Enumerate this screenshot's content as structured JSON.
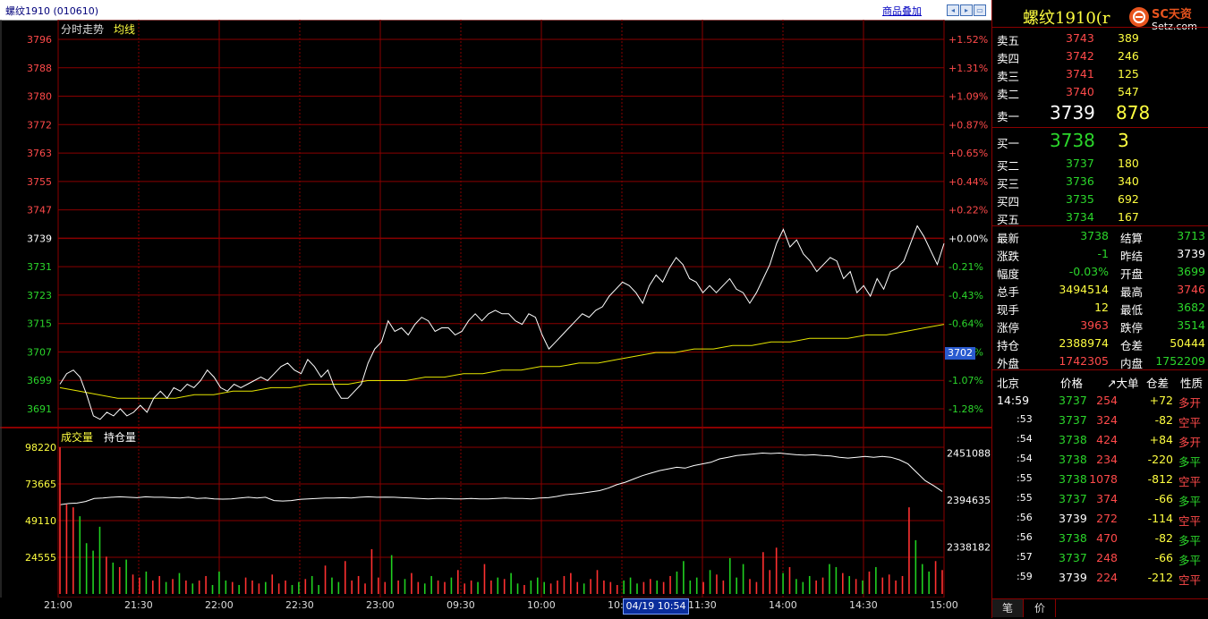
{
  "header": {
    "title": "螺纹1910 (010610)",
    "overlay_button": "商品叠加"
  },
  "chart_labels": {
    "price_caption": "分时走势",
    "avg_caption": "均线",
    "volume_caption": "成交量",
    "oi_caption": "持仓量",
    "current_price_flag": "3702",
    "cursor_time": "04/19 10:54"
  },
  "colors": {
    "up": "#ff4a4a",
    "down": "#2bd62b",
    "grid": "#8a0000",
    "price_line": "#ffffff",
    "avg_line": "#e6e600",
    "volume_up": "#ff3030",
    "volume_down": "#20d020"
  },
  "chart_data": [
    {
      "type": "line",
      "title": "分时走势",
      "y_left_ticks": [
        "3796",
        "3788",
        "3780",
        "3772",
        "3763",
        "3755",
        "3747",
        "3739",
        "3731",
        "3723",
        "3715",
        "3707",
        "3699",
        "3691"
      ],
      "y_right_ticks": [
        "+1.52%",
        "+1.31%",
        "+1.09%",
        "+0.87%",
        "+0.65%",
        "+0.44%",
        "+0.22%",
        "+0.00%",
        "-0.21%",
        "-0.43%",
        "-0.64%",
        "-0.86%",
        "-1.07%",
        "-1.28%"
      ],
      "ylim": [
        3687,
        3799
      ],
      "reference_price": 3739,
      "x_ticks": [
        "21:00",
        "21:30",
        "22:00",
        "22:30",
        "23:00",
        "09:30",
        "10:00",
        "10:30",
        "11:30",
        "14:00",
        "14:30",
        "15:00"
      ],
      "series": [
        {
          "name": "分时走势",
          "values": [
            3698,
            3701,
            3702,
            3700,
            3695,
            3689,
            3688,
            3690,
            3689,
            3691,
            3689,
            3690,
            3692,
            3690,
            3694,
            3696,
            3694,
            3697,
            3696,
            3698,
            3697,
            3699,
            3702,
            3700,
            3697,
            3696,
            3698,
            3697,
            3698,
            3699,
            3700,
            3699,
            3701,
            3703,
            3704,
            3702,
            3701,
            3705,
            3703,
            3700,
            3702,
            3697,
            3694,
            3694,
            3696,
            3698,
            3704,
            3708,
            3710,
            3716,
            3713,
            3714,
            3712,
            3715,
            3717,
            3716,
            3713,
            3714,
            3714,
            3712,
            3713,
            3716,
            3718,
            3716,
            3718,
            3719,
            3718,
            3718,
            3716,
            3715,
            3718,
            3717,
            3712,
            3708,
            3710,
            3712,
            3714,
            3716,
            3718,
            3717,
            3719,
            3720,
            3723,
            3725,
            3727,
            3726,
            3724,
            3721,
            3726,
            3729,
            3727,
            3731,
            3734,
            3732,
            3728,
            3727,
            3724,
            3726,
            3724,
            3726,
            3728,
            3725,
            3724,
            3721,
            3724,
            3728,
            3732,
            3738,
            3742,
            3737,
            3739,
            3735,
            3733,
            3730,
            3732,
            3734,
            3733,
            3728,
            3730,
            3724,
            3726,
            3723,
            3728,
            3725,
            3730,
            3731,
            3733,
            3738,
            3743,
            3740,
            3736,
            3732,
            3738
          ],
          "color": "#ffffff"
        },
        {
          "name": "均线",
          "values": [
            3697,
            3696,
            3695,
            3694,
            3694,
            3694,
            3694,
            3695,
            3695,
            3696,
            3696,
            3697,
            3697,
            3698,
            3698,
            3698,
            3699,
            3699,
            3699,
            3700,
            3700,
            3701,
            3701,
            3702,
            3702,
            3703,
            3703,
            3704,
            3704,
            3705,
            3706,
            3707,
            3707,
            3708,
            3708,
            3709,
            3709,
            3710,
            3710,
            3711,
            3711,
            3711,
            3712,
            3712,
            3713,
            3714,
            3715
          ],
          "color": "#e6e600"
        }
      ]
    },
    {
      "type": "bar",
      "title": "成交量",
      "y_left_ticks": [
        "98220",
        "73665",
        "49110",
        "24555"
      ],
      "y_right_ticks": [
        "2451088",
        "2394635",
        "2338182"
      ],
      "ylim": [
        0,
        98220
      ],
      "values": [
        98220,
        60000,
        58000,
        52000,
        34000,
        29000,
        45000,
        25000,
        21000,
        18000,
        23000,
        13000,
        11000,
        15000,
        9000,
        12000,
        8000,
        10000,
        14000,
        9000,
        7000,
        9000,
        12000,
        6000,
        15000,
        9000,
        8000,
        6000,
        11000,
        9000,
        7000,
        8000,
        13000,
        7000,
        9000,
        6000,
        8000,
        10000,
        12000,
        6000,
        19000,
        11000,
        8000,
        22000,
        9000,
        12000,
        7000,
        30000,
        11000,
        8000,
        26000,
        9000,
        10000,
        14000,
        8000,
        7000,
        12000,
        9000,
        8000,
        11000,
        16000,
        7000,
        9000,
        8000,
        20000,
        9000,
        11000,
        10000,
        14000,
        7000,
        6000,
        9000,
        11000,
        8000,
        7000,
        9000,
        12000,
        14000,
        8000,
        7000,
        10000,
        16000,
        9000,
        8000,
        6000,
        9000,
        11000,
        7000,
        8000,
        10000,
        9000,
        8000,
        12000,
        15000,
        22000,
        9000,
        11000,
        8000,
        16000,
        13000,
        9000,
        24000,
        11000,
        20000,
        10000,
        8000,
        28000,
        16000,
        31000,
        14000,
        18000,
        10000,
        8000,
        12000,
        9000,
        11000,
        20000,
        18000,
        14000,
        12000,
        10000,
        9000,
        15000,
        18000,
        11000,
        13000,
        9000,
        12000,
        58000,
        36000,
        20000,
        15000,
        22000,
        16000
      ],
      "oi_series": {
        "name": "持仓量",
        "values": [
          2389000,
          2390500,
          2391000,
          2393000,
          2396500,
          2397000,
          2398000,
          2398500,
          2398000,
          2397500,
          2398500,
          2398000,
          2398000,
          2397500,
          2397000,
          2398000,
          2396500,
          2397000,
          2396000,
          2395800,
          2396000,
          2397000,
          2398000,
          2397000,
          2398000,
          2394000,
          2393500,
          2394000,
          2395500,
          2396000,
          2396500,
          2397000,
          2397000,
          2397500,
          2397200,
          2398000,
          2398500,
          2398000,
          2398200,
          2398000,
          2397500,
          2397000,
          2396500,
          2396000,
          2396500,
          2396500,
          2396000,
          2396000,
          2396500,
          2396000,
          2396000,
          2396500,
          2397000,
          2396500,
          2396500,
          2396000,
          2397000,
          2397500,
          2399000,
          2401000,
          2402000,
          2403000,
          2404500,
          2406000,
          2409000,
          2413000,
          2416000,
          2420000,
          2424000,
          2427000,
          2430000,
          2432000,
          2434000,
          2433000,
          2436000,
          2438000,
          2440000,
          2444000,
          2446000,
          2448000,
          2449000,
          2450000,
          2451000,
          2450500,
          2451000,
          2450000,
          2449000,
          2448500,
          2449000,
          2448000,
          2447500,
          2446000,
          2445000,
          2446000,
          2447000,
          2446000,
          2447000,
          2446000,
          2443000,
          2438000,
          2428000,
          2418000,
          2412000,
          2405000
        ],
        "ylim": [
          2282000,
          2458000
        ]
      }
    }
  ],
  "side": {
    "contract": "螺纹1910(r",
    "logo_text": "SC天资",
    "logo_sub": "Setz.com",
    "asks": [
      {
        "label": "卖五",
        "price": "3743",
        "qty": "389"
      },
      {
        "label": "卖四",
        "price": "3742",
        "qty": "246"
      },
      {
        "label": "卖三",
        "price": "3741",
        "qty": "125"
      },
      {
        "label": "卖二",
        "price": "3740",
        "qty": "547"
      }
    ],
    "ask1": {
      "label": "卖一",
      "price": "3739",
      "qty": "878"
    },
    "bid1": {
      "label": "买一",
      "price": "3738",
      "qty": "3"
    },
    "bids": [
      {
        "label": "买二",
        "price": "3737",
        "qty": "180"
      },
      {
        "label": "买三",
        "price": "3736",
        "qty": "340"
      },
      {
        "label": "买四",
        "price": "3735",
        "qty": "692"
      },
      {
        "label": "买五",
        "price": "3734",
        "qty": "167"
      }
    ],
    "stats": [
      {
        "l1": "最新",
        "v1": "3738",
        "c1": "green",
        "l2": "结算",
        "v2": "3713",
        "c2": "green"
      },
      {
        "l1": "涨跌",
        "v1": "-1",
        "c1": "green",
        "l2": "昨结",
        "v2": "3739",
        "c2": "white"
      },
      {
        "l1": "幅度",
        "v1": "-0.03%",
        "c1": "green",
        "l2": "开盘",
        "v2": "3699",
        "c2": "green"
      },
      {
        "l1": "总手",
        "v1": "3494514",
        "c1": "yellow",
        "l2": "最高",
        "v2": "3746",
        "c2": "red"
      },
      {
        "l1": "现手",
        "v1": "12",
        "c1": "yellow",
        "l2": "最低",
        "v2": "3682",
        "c2": "green"
      },
      {
        "l1": "涨停",
        "v1": "3963",
        "c1": "red",
        "l2": "跌停",
        "v2": "3514",
        "c2": "green"
      },
      {
        "l1": "持仓",
        "v1": "2388974",
        "c1": "yellow",
        "l2": "仓差",
        "v2": "50444",
        "c2": "yellow"
      },
      {
        "l1": "外盘",
        "v1": "1742305",
        "c1": "red",
        "l2": "内盘",
        "v2": "1752209",
        "c2": "green"
      }
    ],
    "tick_header": {
      "loc": "北京",
      "price": "价格",
      "vol": "↗大单",
      "oi": "仓差",
      "type": "性质"
    },
    "ticks": [
      {
        "t": "14:59",
        "p": "3737",
        "pc": "green",
        "v": "254",
        "d": "+72",
        "dc": "yellow",
        "n": "多开",
        "nc": "red"
      },
      {
        "t": ":53",
        "p": "3737",
        "pc": "green",
        "v": "324",
        "d": "-82",
        "dc": "yellow",
        "n": "空平",
        "nc": "red"
      },
      {
        "t": ":54",
        "p": "3738",
        "pc": "green",
        "v": "424",
        "d": "+84",
        "dc": "yellow",
        "n": "多开",
        "nc": "red"
      },
      {
        "t": ":54",
        "p": "3738",
        "pc": "green",
        "v": "234",
        "d": "-220",
        "dc": "yellow",
        "n": "多平",
        "nc": "green"
      },
      {
        "t": ":55",
        "p": "3738",
        "pc": "green",
        "v": "1078",
        "d": "-812",
        "dc": "yellow",
        "n": "空平",
        "nc": "red"
      },
      {
        "t": ":55",
        "p": "3737",
        "pc": "green",
        "v": "374",
        "d": "-66",
        "dc": "yellow",
        "n": "多平",
        "nc": "green"
      },
      {
        "t": ":56",
        "p": "3739",
        "pc": "white",
        "v": "272",
        "d": "-114",
        "dc": "yellow",
        "n": "空平",
        "nc": "red"
      },
      {
        "t": ":56",
        "p": "3738",
        "pc": "green",
        "v": "470",
        "d": "-82",
        "dc": "yellow",
        "n": "多平",
        "nc": "green"
      },
      {
        "t": ":57",
        "p": "3737",
        "pc": "green",
        "v": "248",
        "d": "-66",
        "dc": "yellow",
        "n": "多平",
        "nc": "green"
      },
      {
        "t": ":59",
        "p": "3739",
        "pc": "white",
        "v": "224",
        "d": "-212",
        "dc": "yellow",
        "n": "空平",
        "nc": "red"
      }
    ],
    "tabs": [
      "笔",
      "价"
    ]
  }
}
